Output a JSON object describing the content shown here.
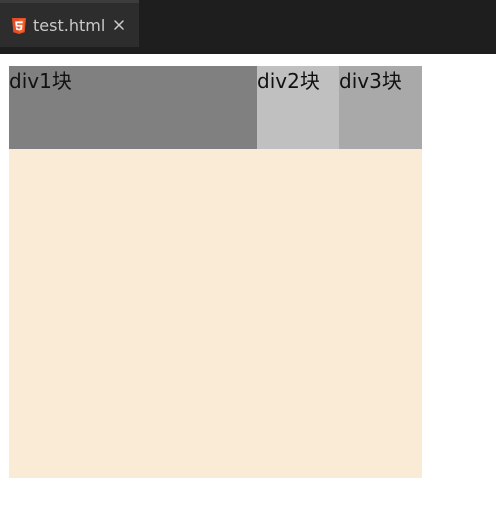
{
  "tabbar": {
    "tabs": [
      {
        "label": "test.html",
        "icon": "html5-icon",
        "close_icon": "close-icon"
      }
    ]
  },
  "page": {
    "blocks": [
      {
        "label": "div1块",
        "color": "#808080"
      },
      {
        "label": "div2块",
        "color": "#c0c0c0"
      },
      {
        "label": "div3块",
        "color": "#a9a9a9"
      }
    ],
    "container_color": "#faebd7"
  },
  "colors": {
    "tabbar_bg": "#1e1e1e",
    "active_tab_bg": "#2d2d2d",
    "html5_orange": "#e44d26"
  }
}
